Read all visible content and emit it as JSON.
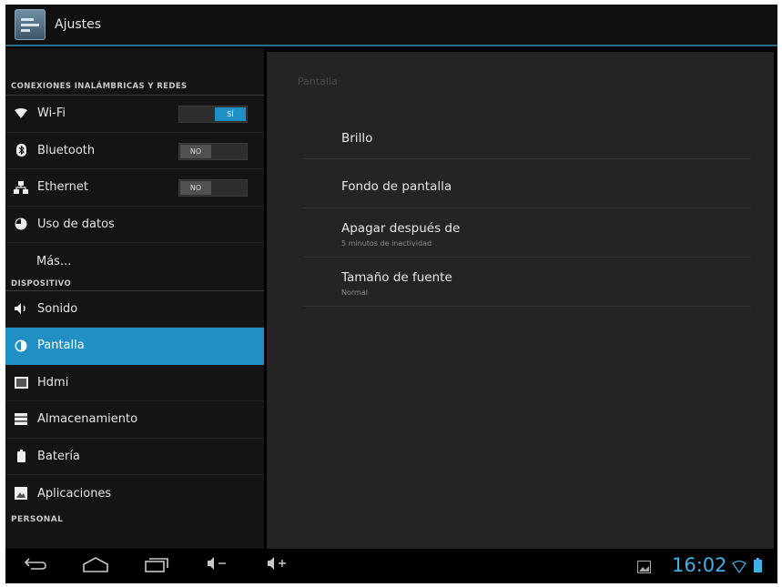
{
  "actionbar": {
    "title": "Ajustes"
  },
  "sections": {
    "wireless": "CONEXIONES INALÁMBRICAS Y REDES",
    "device": "DISPOSITIVO",
    "personal": "PERSONAL"
  },
  "items": {
    "wifi": {
      "label": "Wi-Fi",
      "toggle": "SÍ",
      "state": "on"
    },
    "bluetooth": {
      "label": "Bluetooth",
      "toggle": "NO",
      "state": "off"
    },
    "ethernet": {
      "label": "Ethernet",
      "toggle": "NO",
      "state": "off"
    },
    "data_usage": {
      "label": "Uso de datos"
    },
    "more": {
      "label": "Más..."
    },
    "sound": {
      "label": "Sonido"
    },
    "display": {
      "label": "Pantalla",
      "selected": true
    },
    "hdmi": {
      "label": "Hdmi"
    },
    "storage": {
      "label": "Almacenamiento"
    },
    "battery": {
      "label": "Batería"
    },
    "apps": {
      "label": "Aplicaciones"
    }
  },
  "right": {
    "header": "Pantalla",
    "prefs": [
      {
        "title": "Brillo",
        "summary": ""
      },
      {
        "title": "Fondo de pantalla",
        "summary": ""
      },
      {
        "title": "Apagar después de",
        "summary": "5 minutos de inactividad"
      },
      {
        "title": "Tamaño de fuente",
        "summary": "Normal"
      }
    ]
  },
  "navbar": {
    "icons": [
      "back-icon",
      "home-icon",
      "recent-apps-icon",
      "volume-down-icon",
      "volume-up-icon"
    ],
    "clock": "16:02"
  },
  "colors": {
    "accent": "#1f8fc4",
    "clock": "#3fb1e3"
  }
}
